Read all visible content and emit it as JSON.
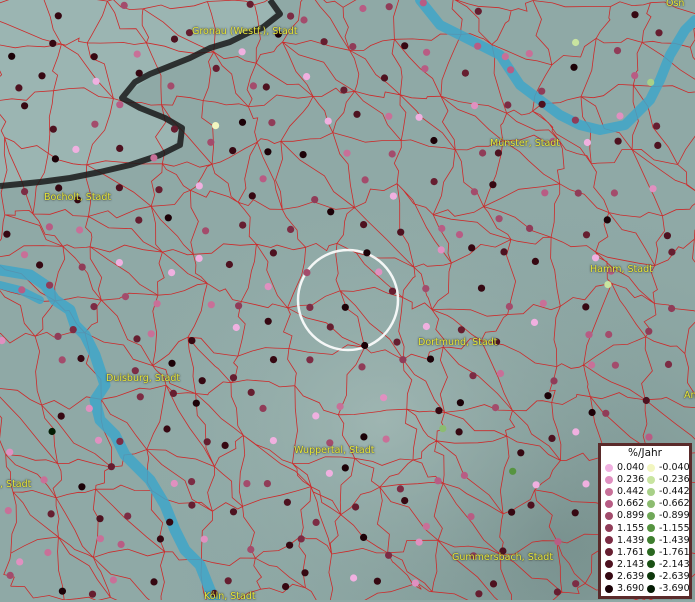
{
  "labels": {
    "cities": [
      {
        "name": "Gronau (Westf.), Stadt",
        "pos": "top-center"
      },
      {
        "name": "Münster, Stadt",
        "pos": "upper-right"
      },
      {
        "name": "Bocholt, Stadt",
        "pos": "left"
      },
      {
        "name": "Hamm, Stadt",
        "pos": "right"
      },
      {
        "name": "Dortmund, Stadt",
        "pos": "center-right"
      },
      {
        "name": "Duisburg, Stadt",
        "pos": "left-center"
      },
      {
        "name": "Wuppertal, Stadt",
        "pos": "lower-center"
      },
      {
        "name": "Gummersbach, Stadt",
        "pos": "lower-right"
      },
      {
        "name": "Köln, Stadt",
        "pos": "bottom"
      }
    ],
    "clipped": [
      "Osn",
      "An",
      ", Stadt"
    ]
  },
  "legend": {
    "title": "%/Jahr",
    "positive": [
      {
        "value": "0.040",
        "color": "#f0b0e0"
      },
      {
        "value": "0.236",
        "color": "#e090c0"
      },
      {
        "value": "0.442",
        "color": "#c87098"
      },
      {
        "value": "0.662",
        "color": "#b85c84"
      },
      {
        "value": "0.899",
        "color": "#a34c6c"
      },
      {
        "value": "1.155",
        "color": "#903c58"
      },
      {
        "value": "1.439",
        "color": "#7c2c44"
      },
      {
        "value": "1.761",
        "color": "#661e30"
      },
      {
        "value": "2.143",
        "color": "#4e1220"
      },
      {
        "value": "2.639",
        "color": "#360812"
      },
      {
        "value": "3.690",
        "color": "#1c0208"
      }
    ],
    "negative": [
      {
        "value": "-0.040",
        "color": "#f2f6c0"
      },
      {
        "value": "-0.236",
        "color": "#c8e4a0"
      },
      {
        "value": "-0.442",
        "color": "#a8d088"
      },
      {
        "value": "-0.662",
        "color": "#8cbc70"
      },
      {
        "value": "-0.899",
        "color": "#70a858"
      },
      {
        "value": "-1.155",
        "color": "#569440"
      },
      {
        "value": "-1.439",
        "color": "#3e7e2e"
      },
      {
        "value": "-1.761",
        "color": "#2a6820"
      },
      {
        "value": "-2.143",
        "color": "#1a5014"
      },
      {
        "value": "-2.639",
        "color": "#0e380c"
      },
      {
        "value": "-3.690",
        "color": "#041c04"
      }
    ]
  },
  "colors": {
    "land": "#8fa9a6",
    "water": "#3fa6c8",
    "border": "#cc2a2a",
    "national_border": "#1a1a1a",
    "label": "#e8e83a"
  }
}
